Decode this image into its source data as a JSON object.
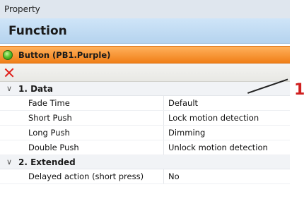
{
  "header": {
    "title": "Property"
  },
  "function_header": {
    "title": "Function"
  },
  "object": {
    "label": "Button (PB1.Purple)",
    "status_color": "#4caf28"
  },
  "toolbar": {
    "delete_icon": "close-icon"
  },
  "categories": [
    {
      "title": "1. Data",
      "properties": [
        {
          "name": "Fade Time",
          "value": "Default"
        },
        {
          "name": "Short Push",
          "value": "Lock motion detection"
        },
        {
          "name": "Long Push",
          "value": "Dimming"
        },
        {
          "name": "Double Push",
          "value": "Unlock motion detection"
        }
      ]
    },
    {
      "title": "2. Extended",
      "properties": [
        {
          "name": "Delayed action (short press)",
          "value": "No"
        }
      ]
    }
  ],
  "callout": {
    "number": "1"
  }
}
